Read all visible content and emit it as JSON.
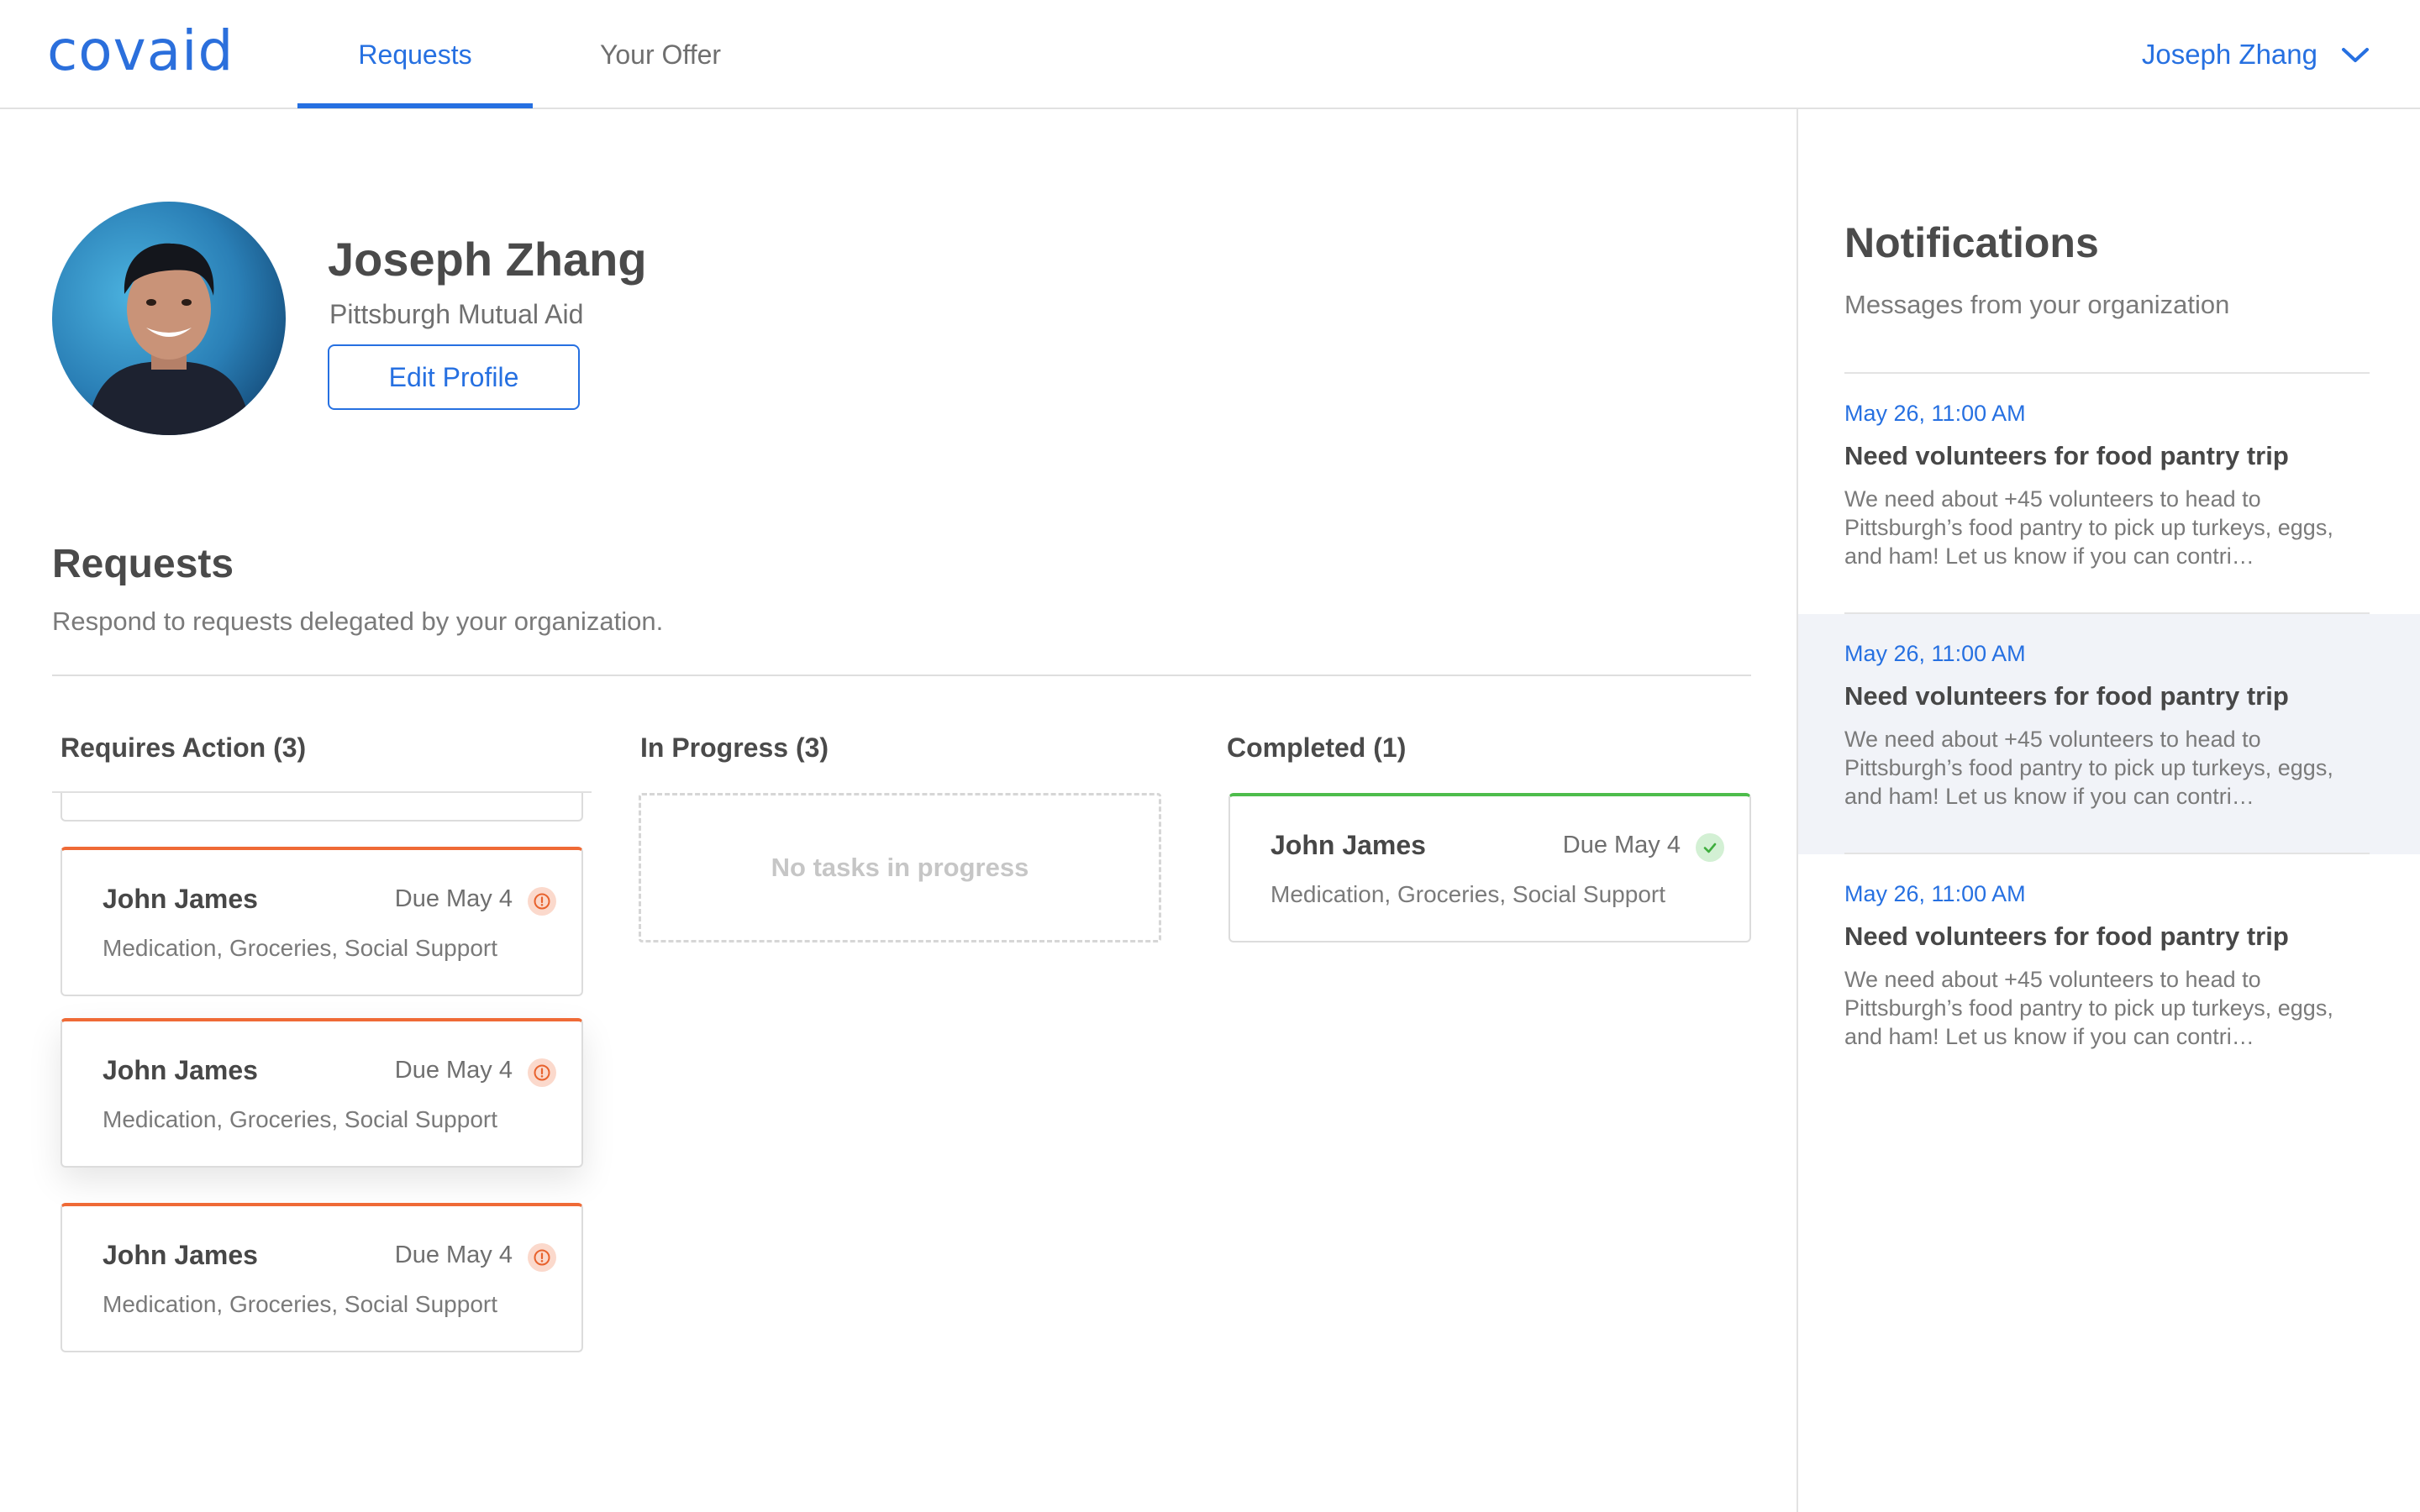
{
  "nav": {
    "logo": "covaid",
    "tabs": [
      {
        "label": "Requests",
        "active": true
      },
      {
        "label": "Your Offer",
        "active": false
      }
    ],
    "user_name": "Joseph Zhang",
    "accent_color": "#2670e1"
  },
  "profile": {
    "name": "Joseph Zhang",
    "organization": "Pittsburgh Mutual Aid",
    "edit_label": "Edit Profile"
  },
  "requests": {
    "title": "Requests",
    "subtitle": "Respond to requests delegated by your organization.",
    "columns": {
      "requires_action": {
        "title": "Requires Action (3)",
        "cards": [
          {
            "name": "John James",
            "due": "Due May 4",
            "tags": "Medication, Groceries, Social Support",
            "icon": "alert-icon"
          },
          {
            "name": "John James",
            "due": "Due May 4",
            "tags": "Medication, Groceries, Social Support",
            "icon": "alert-icon"
          },
          {
            "name": "John James",
            "due": "Due May 4",
            "tags": "Medication, Groceries, Social Support",
            "icon": "alert-icon"
          }
        ]
      },
      "in_progress": {
        "title": "In Progress (3)",
        "empty_text": "No tasks in progress"
      },
      "completed": {
        "title": "Completed (1)",
        "cards": [
          {
            "name": "John James",
            "due": "Due May 4",
            "tags": "Medication, Groceries, Social Support",
            "icon": "check-icon"
          }
        ]
      }
    },
    "colors": {
      "urgent": "#ef6a36",
      "complete": "#4dbd4b"
    }
  },
  "notifications": {
    "title": "Notifications",
    "subtitle": "Messages from your organization",
    "items": [
      {
        "time": "May 26, 11:00 AM",
        "title": "Need volunteers for food pantry trip",
        "body": "We need about +45 volunteers to head to Pittsburgh’s food pantry to pick up turkeys, eggs, and ham! Let us know if you can contri…"
      },
      {
        "time": "May 26, 11:00 AM",
        "title": "Need volunteers for food pantry trip",
        "body": "We need about +45 volunteers to head to Pittsburgh’s food pantry to pick up turkeys, eggs, and ham! Let us know if you can contri…"
      },
      {
        "time": "May 26, 11:00 AM",
        "title": "Need volunteers for food pantry trip",
        "body": "We need about +45 volunteers to head to Pittsburgh’s food pantry to pick up turkeys, eggs, and ham! Let us know if you can contri…"
      }
    ]
  }
}
